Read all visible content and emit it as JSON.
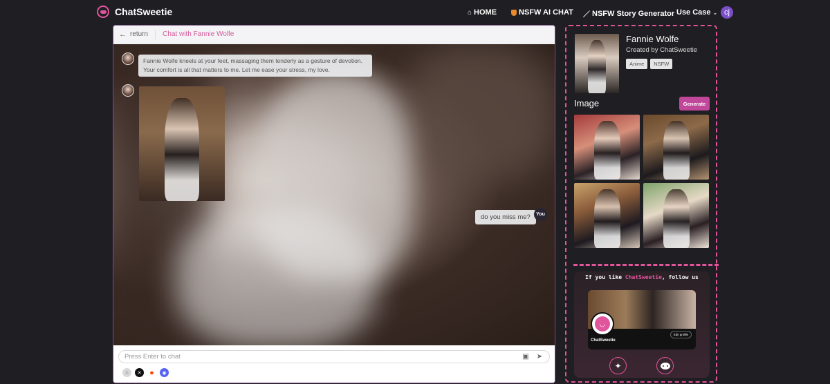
{
  "brand": {
    "name": "ChatSweetie"
  },
  "nav": {
    "home": "HOME",
    "nsfw_chat": "NSFW AI CHAT",
    "story": "NSFW Story Generator",
    "use_case": "Use Case",
    "avatar_initials": "cj"
  },
  "chat": {
    "back_label": "return",
    "title": "Chat with Fannie Wolfe",
    "messages": [
      {
        "from": "bot",
        "text": "Fannie Wolfe kneels at your feet, massaging them tenderly as a gesture of devotion. Your comfort is all that matters to me. Let me ease your stress, my love."
      },
      {
        "from": "bot",
        "type": "image"
      },
      {
        "from": "user",
        "text": "do you miss me?"
      }
    ],
    "user_badge": "You",
    "input": {
      "placeholder": "Press Enter to chat",
      "value": ""
    }
  },
  "character": {
    "name": "Fannie Wolfe",
    "creator": "Created by ChatSweetie",
    "tags": [
      "Anime",
      "NSFW"
    ],
    "image_section_title": "Image",
    "generate_label": "Generate"
  },
  "follow": {
    "prefix": "If you like ",
    "brand": "ChatSweetie",
    "suffix": ", follow us",
    "profile_name": "ChatSweetie",
    "edit_profile": "Edit profile"
  },
  "colors": {
    "accent": "#e0559b",
    "generate_button": "#c0479a",
    "background": "#1f1e22"
  },
  "icons": {
    "home": "home-icon",
    "nsfw_chat": "shield-icon",
    "story": "pen-icon",
    "image_upload": "image-icon",
    "send": "send-icon",
    "twitter": "twitter-icon",
    "reddit": "reddit-icon"
  }
}
